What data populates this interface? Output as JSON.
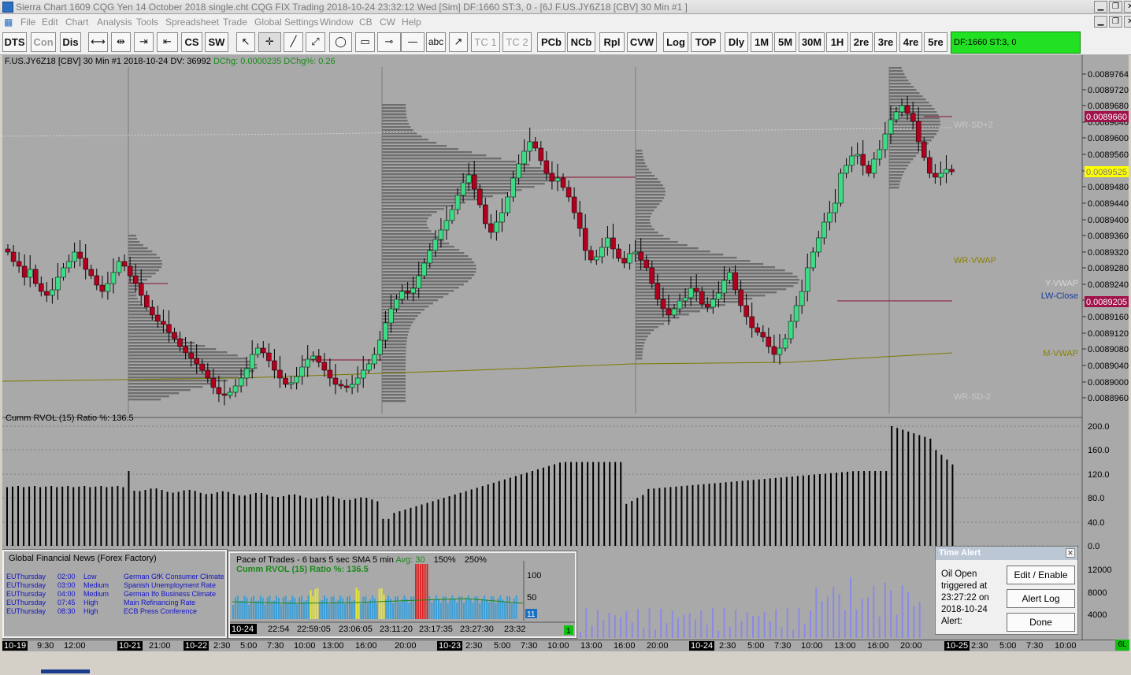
{
  "title": "Sierra Chart 1609 CQG Yen 14 October 2018 single.cht  CQG FIX Trading 2018-10-24  23:32:12 Wed [Sim]  DF:1660  ST:3, 0 - [6J  F.US.JY6Z18 [CBV]  30 Min   #1 ]",
  "menu": [
    "File",
    "Edit",
    "Chart",
    "Analysis",
    "Tools",
    "Spreadsheet",
    "Trade",
    "Global Settings",
    "Window",
    "CB",
    "CW",
    "Help"
  ],
  "toolbar": {
    "dts": "DTS",
    "con": "Con",
    "dis": "Dis",
    "cs": "CS",
    "sw": "SW",
    "abc": "abc",
    "tc1": "TC 1",
    "tc2": "TC 2",
    "pcb": "PCb",
    "ncb": "NCb",
    "rpl": "Rpl",
    "cvw": "CVW",
    "log": "Log",
    "top": "TOP",
    "dly": "Dly",
    "m1": "1M",
    "m5": "5M",
    "m30": "30M",
    "h1": "1H",
    "re2": "2re",
    "re3": "3re",
    "re4": "4re",
    "re5": "5re",
    "status": "DF:1660  ST:3, 0"
  },
  "chart_header": {
    "symbol_info": "F.US.JY6Z18 [CBV]  30 Min   #1 2018-10-24 DV: 36992",
    "dchg": "DChg: 0.0000235 DChg%: 0.26"
  },
  "price_axis": [
    "0.0089764",
    "0.0089720",
    "0.0089680",
    "0.0089640",
    "0.0089600",
    "0.0089560",
    "0.0089520",
    "0.0089480",
    "0.0089440",
    "0.0089400",
    "0.0089360",
    "0.0089320",
    "0.0089280",
    "0.0089240",
    "0.0089200",
    "0.0089160",
    "0.0089120",
    "0.0089080",
    "0.0089040",
    "0.0089000",
    "0.0088960"
  ],
  "price_markers": [
    {
      "text": "0.0089660",
      "bg": "#a0124a",
      "fg": "#ffffff"
    },
    {
      "text": "0.0089525",
      "bg": "#ffff00",
      "fg": "#777777"
    },
    {
      "text": "0.0089205",
      "bg": "#a0124a",
      "fg": "#ffffff"
    }
  ],
  "line_labels": {
    "wr_sd_plus": "WR-SD+2",
    "wr_vwap": "WR-VWAP",
    "y_vwap": "Y-VWAP",
    "lw_close": "LW-Close",
    "m_vwap": "M-VWAP",
    "wr_sd_minus": "WR-SD-2"
  },
  "rvol": {
    "label": "Cumm RVOL (15)  Ratio %: 136.5",
    "axis": [
      "200.0",
      "160.0",
      "120.0",
      "80.0",
      "40.0",
      "0.0"
    ]
  },
  "volume_axis": [
    "12000",
    "8000",
    "4000"
  ],
  "x_axis": [
    "10-19",
    "9:30",
    "12:00",
    "10-21",
    "21:00",
    "10-22",
    "2:30",
    "5:00",
    "7:30",
    "10:00",
    "13:00",
    "16:00",
    "20:00",
    "10-23",
    "2:30",
    "5:00",
    "7:30",
    "10:00",
    "13:00",
    "16:00",
    "20:00",
    "10-24",
    "2:30",
    "5:00",
    "7:30",
    "10:00",
    "13:00",
    "16:00",
    "20:00",
    "10-25",
    "2:30",
    "5:00",
    "7:30",
    "10:00"
  ],
  "news": {
    "title": "Global Financial News (Forex Factory)",
    "rows": [
      {
        "cur": "EUThursday",
        "time": "02:00",
        "impact": "Low",
        "event": "German GfK Consumer Climate"
      },
      {
        "cur": "EUThursday",
        "time": "03:00",
        "impact": "Medium",
        "event": "Spanish Unemployment Rate"
      },
      {
        "cur": "EUThursday",
        "time": "04:00",
        "impact": "Medium",
        "event": "German Ifo Business Climate"
      },
      {
        "cur": "EUThursday",
        "time": "07:45",
        "impact": "High",
        "event": "Main Refinancing Rate"
      },
      {
        "cur": "EUThursday",
        "time": "08:30",
        "impact": "High",
        "event": "ECB Press Conference"
      }
    ]
  },
  "pace": {
    "title": "Pace of Trades - 6 bars 5 sec  SMA 5 min",
    "avg": "Avg: 30",
    "pct1": "150%",
    "pct2": "250%",
    "sub": "Cumm RVOL (15) Ratio %: 136.5",
    "axis": [
      "100",
      "50"
    ],
    "current": "11",
    "x_axis": [
      "10-24",
      "22:54",
      "22:59:05",
      "23:06:05",
      "23:11:20",
      "23:17:35",
      "23:27:30",
      "23:32"
    ],
    "corner": "1"
  },
  "time_alert": {
    "caption": "Time Alert",
    "message": [
      "Oil Open",
      "triggered at",
      "23:27:22 on",
      "2018-10-24",
      "Alert:"
    ],
    "edit_button": "Edit / Enable",
    "log_button": "Alert Log",
    "done_button": "Done"
  },
  "corner_label": "6L",
  "colors": {
    "up": "#3ddc84",
    "down": "#b0001e",
    "chart_bg": "#a9a9a9",
    "profile": "#6e6e6e"
  }
}
